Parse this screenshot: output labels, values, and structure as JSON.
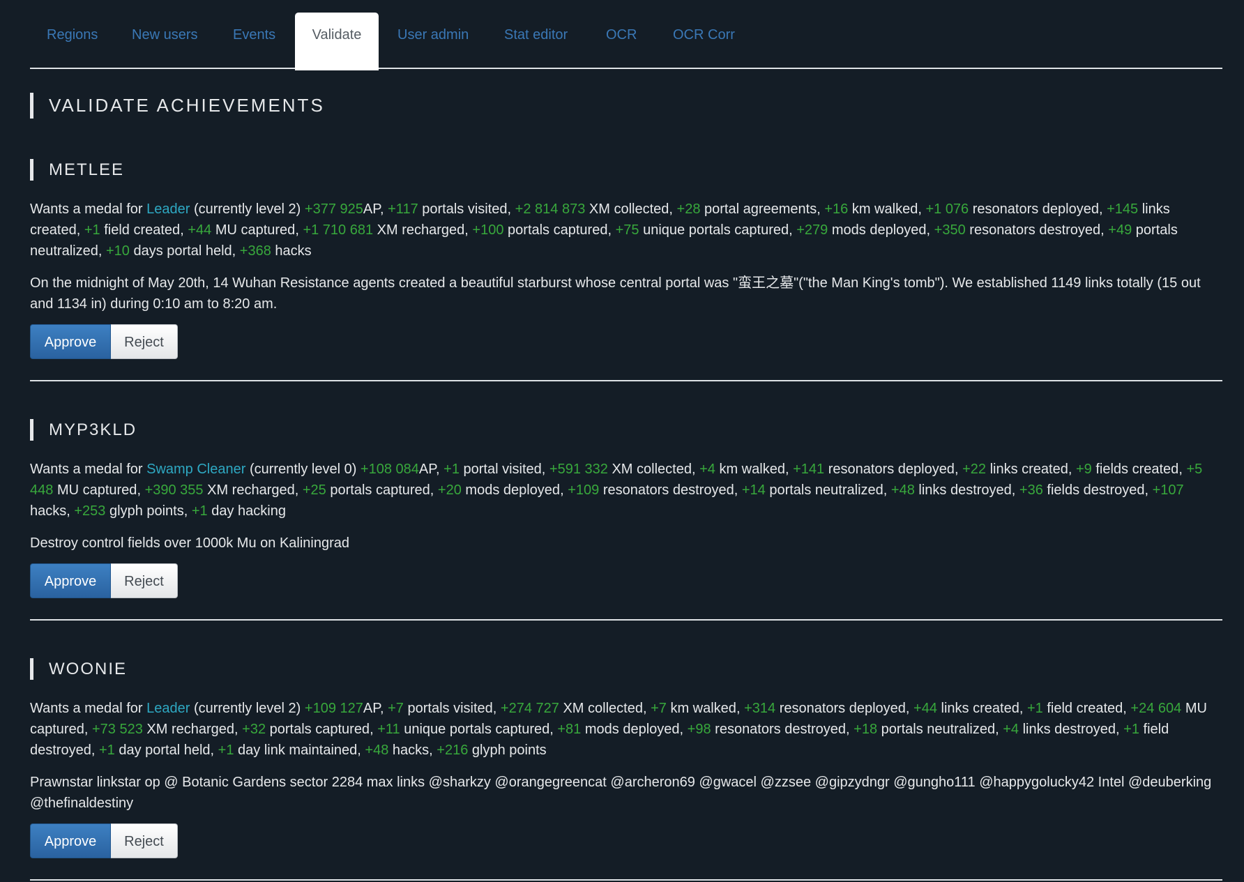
{
  "tabs": [
    {
      "label": "Regions",
      "active": false
    },
    {
      "label": "New users",
      "active": false
    },
    {
      "label": "Events",
      "active": false
    },
    {
      "label": "Validate",
      "active": true
    },
    {
      "label": "User admin",
      "active": false
    },
    {
      "label": "Stat editor",
      "active": false
    },
    {
      "label": "OCR",
      "active": false
    },
    {
      "label": "OCR Corr",
      "active": false
    }
  ],
  "page_title": "VALIDATE ACHIEVEMENTS",
  "colors": {
    "background": "#141d26",
    "text": "#e6e8ea",
    "stat_number": "#38a83c",
    "medal_link": "#2ea8c2",
    "tab_link": "#3a78b6",
    "approve": "#2f6aa8"
  },
  "buttons": {
    "approve_label": "Approve",
    "reject_label": "Reject"
  },
  "entries": [
    {
      "name": "METLEE",
      "prefix": "Wants a medal for",
      "medal": "Leader",
      "level": "(currently level 2)",
      "stats": [
        {
          "value": "+377 925",
          "label": "AP"
        },
        {
          "value": "+117",
          "label": "portals visited"
        },
        {
          "value": "+2 814 873",
          "label": "XM collected"
        },
        {
          "value": "+28",
          "label": "portal agreements"
        },
        {
          "value": "+16",
          "label": "km walked"
        },
        {
          "value": "+1 076",
          "label": "resonators deployed"
        },
        {
          "value": "+145",
          "label": "links created"
        },
        {
          "value": "+1",
          "label": "field created"
        },
        {
          "value": "+44",
          "label": "MU captured"
        },
        {
          "value": "+1 710 681",
          "label": "XM recharged"
        },
        {
          "value": "+100",
          "label": "portals captured"
        },
        {
          "value": "+75",
          "label": "unique portals captured"
        },
        {
          "value": "+279",
          "label": "mods deployed"
        },
        {
          "value": "+350",
          "label": "resonators destroyed"
        },
        {
          "value": "+49",
          "label": "portals neutralized"
        },
        {
          "value": "+10",
          "label": "days portal held"
        },
        {
          "value": "+368",
          "label": "hacks"
        }
      ],
      "note": "On the midnight of May 20th, 14 Wuhan Resistance agents created a beautiful starburst whose central portal was \"蛮王之墓\"(\"the Man King's tomb\"). We established 1149 links totally (15 out and 1134 in) during 0:10 am to 8:20 am."
    },
    {
      "name": "MYP3KLD",
      "prefix": "Wants a medal for",
      "medal": "Swamp Cleaner",
      "level": "(currently level 0)",
      "stats": [
        {
          "value": "+108 084",
          "label": "AP"
        },
        {
          "value": "+1",
          "label": "portal visited"
        },
        {
          "value": "+591 332",
          "label": "XM collected"
        },
        {
          "value": "+4",
          "label": "km walked"
        },
        {
          "value": "+141",
          "label": "resonators deployed"
        },
        {
          "value": "+22",
          "label": "links created"
        },
        {
          "value": "+9",
          "label": "fields created"
        },
        {
          "value": "+5 448",
          "label": "MU captured"
        },
        {
          "value": "+390 355",
          "label": "XM recharged"
        },
        {
          "value": "+25",
          "label": "portals captured"
        },
        {
          "value": "+20",
          "label": "mods deployed"
        },
        {
          "value": "+109",
          "label": "resonators destroyed"
        },
        {
          "value": "+14",
          "label": "portals neutralized"
        },
        {
          "value": "+48",
          "label": "links destroyed"
        },
        {
          "value": "+36",
          "label": "fields destroyed"
        },
        {
          "value": "+107",
          "label": "hacks"
        },
        {
          "value": "+253",
          "label": "glyph points"
        },
        {
          "value": "+1",
          "label": "day hacking"
        }
      ],
      "note": "Destroy control fields over 1000k Mu on Kaliningrad"
    },
    {
      "name": "WOONIE",
      "prefix": "Wants a medal for",
      "medal": "Leader",
      "level": "(currently level 2)",
      "stats": [
        {
          "value": "+109 127",
          "label": "AP"
        },
        {
          "value": "+7",
          "label": "portals visited"
        },
        {
          "value": "+274 727",
          "label": "XM collected"
        },
        {
          "value": "+7",
          "label": "km walked"
        },
        {
          "value": "+314",
          "label": "resonators deployed"
        },
        {
          "value": "+44",
          "label": "links created"
        },
        {
          "value": "+1",
          "label": "field created"
        },
        {
          "value": "+24 604",
          "label": "MU captured"
        },
        {
          "value": "+73 523",
          "label": "XM recharged"
        },
        {
          "value": "+32",
          "label": "portals captured"
        },
        {
          "value": "+11",
          "label": "unique portals captured"
        },
        {
          "value": "+81",
          "label": "mods deployed"
        },
        {
          "value": "+98",
          "label": "resonators destroyed"
        },
        {
          "value": "+18",
          "label": "portals neutralized"
        },
        {
          "value": "+4",
          "label": "links destroyed"
        },
        {
          "value": "+1",
          "label": "field destroyed"
        },
        {
          "value": "+1",
          "label": "day portal held"
        },
        {
          "value": "+1",
          "label": "day link maintained"
        },
        {
          "value": "+48",
          "label": "hacks"
        },
        {
          "value": "+216",
          "label": "glyph points"
        }
      ],
      "note": "Prawnstar linkstar op @ Botanic Gardens sector 2284 max links @sharkzy @orangegreencat @archeron69 @gwacel @zzsee @gipzydngr @gungho111 @happygolucky42 Intel @deuberking @thefinaldestiny"
    }
  ]
}
